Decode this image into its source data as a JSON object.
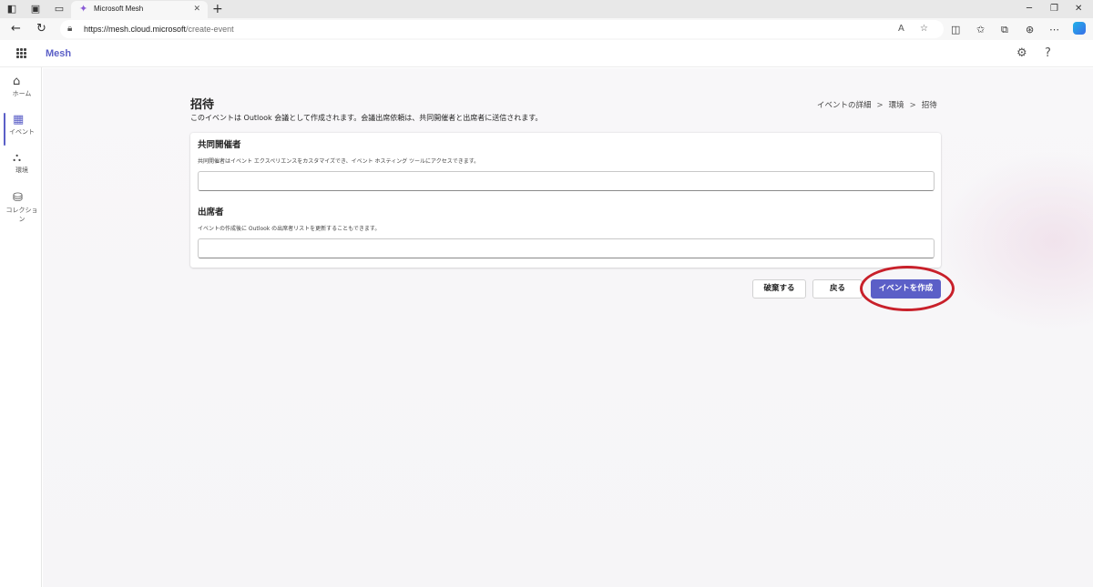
{
  "browser": {
    "tab_title": "Microsoft Mesh",
    "url_host": "https://mesh.cloud.microsoft",
    "url_path": "/create-event",
    "tab_close": "✕",
    "new_tab": "+"
  },
  "app": {
    "name": "Mesh"
  },
  "rail": {
    "items": [
      {
        "label": "ホーム",
        "icon": "home-icon",
        "active": false
      },
      {
        "label": "イベント",
        "icon": "calendar-icon",
        "active": true
      },
      {
        "label": "環境",
        "icon": "environments-icon",
        "active": false
      },
      {
        "label": "コレクション",
        "icon": "collections-icon",
        "active": false
      }
    ]
  },
  "page": {
    "title": "招待",
    "subtitle": "このイベントは Outlook 会議として作成されます。会議出席依頼は、共同開催者と出席者に送信されます。",
    "breadcrumb": [
      "イベントの詳細",
      "環境",
      "招待"
    ],
    "breadcrumb_sep": ">"
  },
  "form": {
    "coorganizers": {
      "title": "共同開催者",
      "description": "共同開催者はイベント エクスペリエンスをカスタマイズでき、イベント ホスティング ツールにアクセスできます。",
      "value": ""
    },
    "attendees": {
      "title": "出席者",
      "description": "イベントの作成後に Outlook の出席者リストを更新することもできます。",
      "value": ""
    }
  },
  "actions": {
    "discard_label": "破棄する",
    "back_label": "戻る",
    "create_label": "イベントを作成"
  },
  "colors": {
    "accent": "#5b5fc7",
    "highlight": "#c8202a"
  }
}
